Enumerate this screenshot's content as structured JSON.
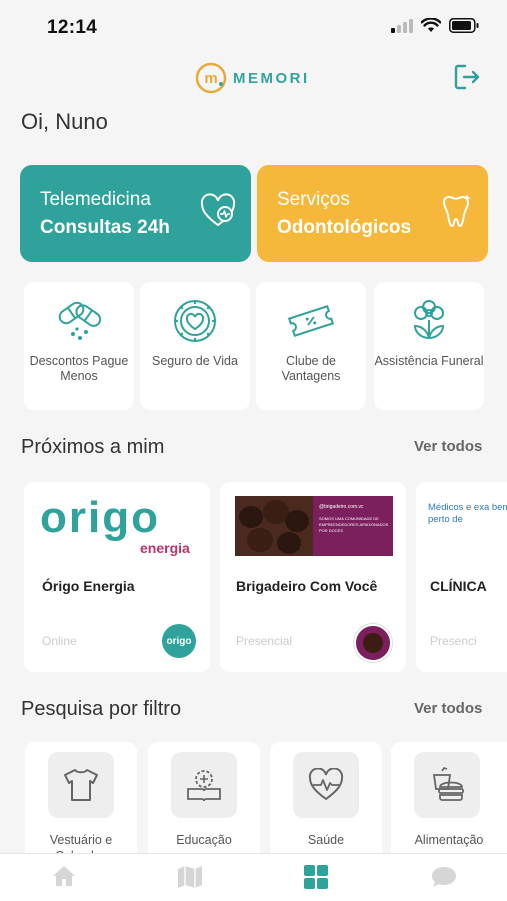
{
  "status": {
    "time": "12:14"
  },
  "header": {
    "brand": "MEMORI",
    "logo_mark": "m"
  },
  "greeting": "Oi, Nuno",
  "banners": [
    {
      "line1": "Telemedicina",
      "line2": "Consultas 24h",
      "color": "#2fa39b",
      "icon": "heart-pulse-icon"
    },
    {
      "line1": "Serviços",
      "line2": "Odontológicos",
      "color": "#f5b83b",
      "icon": "tooth-icon"
    }
  ],
  "services": [
    {
      "label": "Descontos Pague Menos",
      "icon": "pills-icon"
    },
    {
      "label": "Seguro de Vida",
      "icon": "heart-shield-icon"
    },
    {
      "label": "Clube de Vantagens",
      "icon": "ticket-icon"
    },
    {
      "label": "Assistência Funeral",
      "icon": "flower-icon"
    }
  ],
  "nearby": {
    "title": "Próximos a mim",
    "see_all": "Ver todos",
    "items": [
      {
        "name": "Órigo Energia",
        "mode": "Online",
        "logo_word": "origo",
        "logo_sub": "energia",
        "badge_text": "origo"
      },
      {
        "name": "Brigadeiro Com Você",
        "mode": "Presencial",
        "banner_text": "@brigadeiro.com.vc",
        "banner_sub": "SOMOS UMA COMUNIDADE DE EMPREENDEDORES APAIXONADOS POR DOCES"
      },
      {
        "name": "CLÍNICA",
        "mode": "Presenci",
        "banner_text": "Médicos e exa bem perto de"
      }
    ]
  },
  "filters": {
    "title": "Pesquisa por filtro",
    "see_all": "Ver todos",
    "items": [
      {
        "label": "Vestuário e Calçados",
        "icon": "tshirt-icon"
      },
      {
        "label": "Educação",
        "icon": "book-icon"
      },
      {
        "label": "Saúde",
        "icon": "heart-pulse-icon"
      },
      {
        "label": "Alimentação",
        "icon": "food-icon"
      }
    ]
  },
  "tabbar": {
    "items": [
      "home-icon",
      "map-icon",
      "grid-icon",
      "chat-icon"
    ],
    "active": "grid-icon"
  },
  "colors": {
    "teal": "#2fa39b",
    "yellow": "#f5b83b",
    "logo_orange": "#e9a93a"
  }
}
